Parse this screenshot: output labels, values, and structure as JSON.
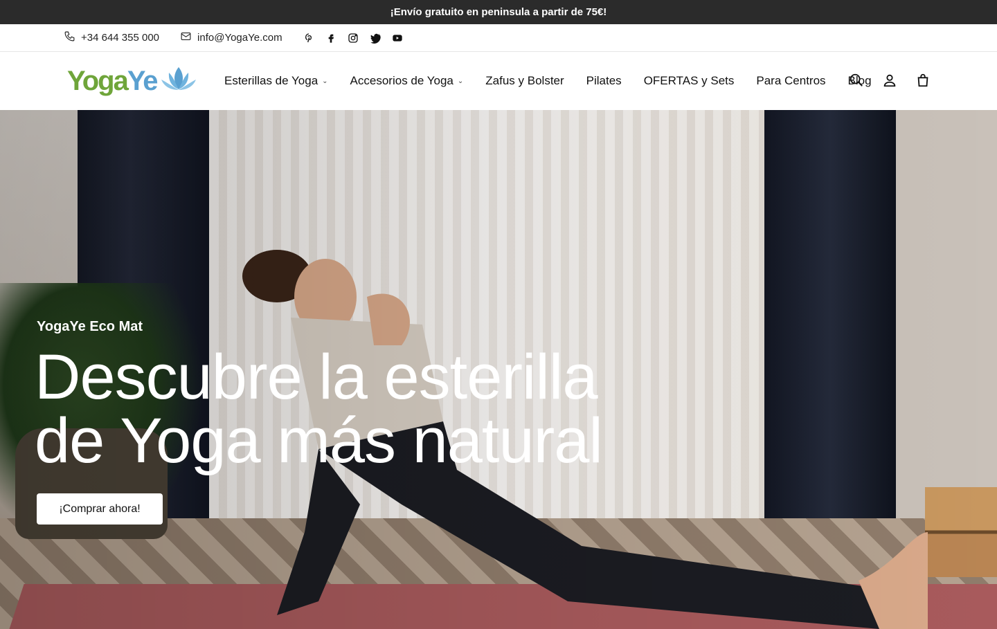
{
  "announcement": "¡Envío gratuito en peninsula a partir de 75€!",
  "topbar": {
    "phone": "+34 644 355 000",
    "email": "info@YogaYe.com",
    "socials": [
      "pinterest-icon",
      "facebook-icon",
      "instagram-icon",
      "twitter-icon",
      "youtube-icon"
    ]
  },
  "logo": {
    "part1": "Yoga",
    "part2": "Ye",
    "color1": "#6fa53a",
    "color2": "#5aa0d0"
  },
  "nav": {
    "items": [
      {
        "label": "Esterillas de Yoga",
        "dropdown": true
      },
      {
        "label": "Accesorios de Yoga",
        "dropdown": true
      },
      {
        "label": "Zafus y Bolster",
        "dropdown": false
      },
      {
        "label": "Pilates",
        "dropdown": false
      },
      {
        "label": "OFERTAS y Sets",
        "dropdown": false
      },
      {
        "label": "Para Centros",
        "dropdown": false
      },
      {
        "label": "Blog",
        "dropdown": false
      }
    ],
    "icons": [
      "search-icon",
      "account-icon",
      "cart-icon"
    ]
  },
  "hero": {
    "subtitle": "YogaYe Eco Mat",
    "title_line1": "Descubre la esterilla",
    "title_line2": "de Yoga más natural",
    "cta": "¡Comprar ahora!"
  }
}
